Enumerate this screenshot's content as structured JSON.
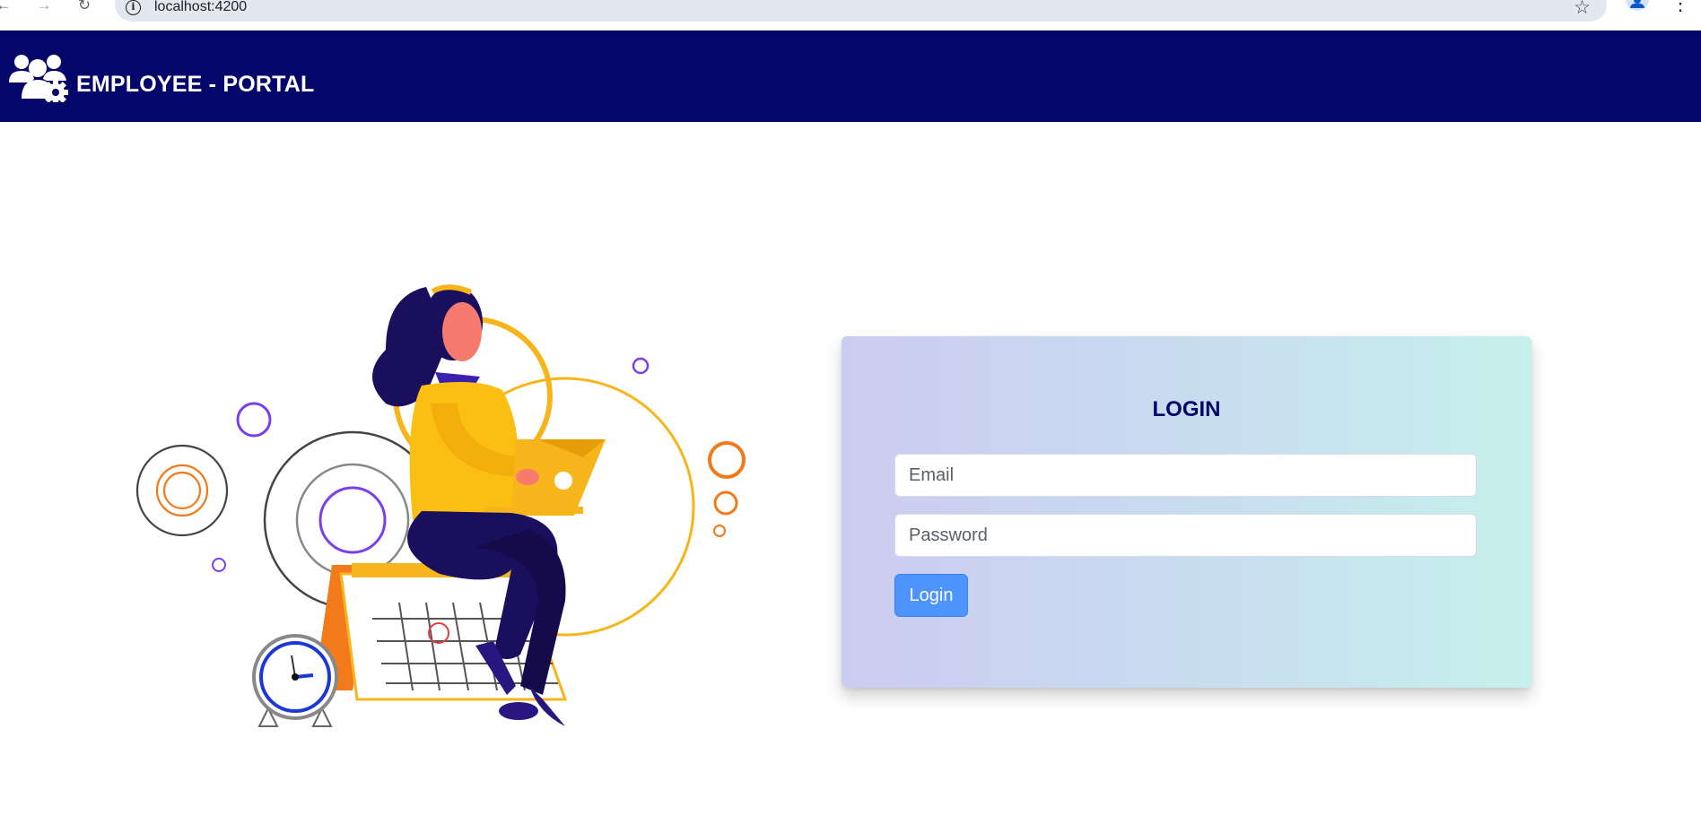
{
  "browser": {
    "url": "localhost:4200",
    "back_icon": "arrow-left-icon",
    "forward_icon": "arrow-right-icon",
    "reload_icon": "reload-icon"
  },
  "header": {
    "brand": "EMPLOYEE - PORTAL",
    "logo_icon": "users-gear-icon",
    "background": "#050669"
  },
  "login": {
    "title": "LOGIN",
    "email_placeholder": "Email",
    "email_value": "",
    "password_placeholder": "Password",
    "password_value": "",
    "button_label": "Login",
    "button_color": "#4d94ff"
  }
}
